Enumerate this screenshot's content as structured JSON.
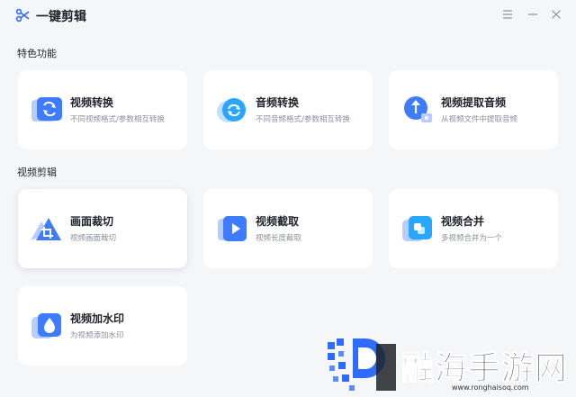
{
  "app": {
    "title": "一键剪辑"
  },
  "sections": [
    {
      "title": "特色功能",
      "cards": [
        {
          "name": "视频转换",
          "desc": "不同视频格式/参数相互转换",
          "icon": "video-convert-icon"
        },
        {
          "name": "音频转换",
          "desc": "不同音频格式/参数相互转换",
          "icon": "audio-convert-icon"
        },
        {
          "name": "视频提取音频",
          "desc": "从视频文件中提取音频",
          "icon": "extract-audio-icon"
        }
      ]
    },
    {
      "title": "视频剪辑",
      "cards": [
        {
          "name": "画面裁切",
          "desc": "视频画面裁切",
          "icon": "crop-icon"
        },
        {
          "name": "视频截取",
          "desc": "视频长度截取",
          "icon": "video-trim-icon"
        },
        {
          "name": "视频合并",
          "desc": "多视频合并为一个",
          "icon": "merge-icon"
        },
        {
          "name": "视频加水印",
          "desc": "为视频添加水印",
          "icon": "watermark-icon"
        }
      ]
    }
  ],
  "watermark": {
    "text": "融海手游网",
    "url": "www.ronghaisoq.com"
  },
  "colors": {
    "accent": "#2f6bff",
    "background": "#f5f6f8",
    "card": "#ffffff"
  }
}
